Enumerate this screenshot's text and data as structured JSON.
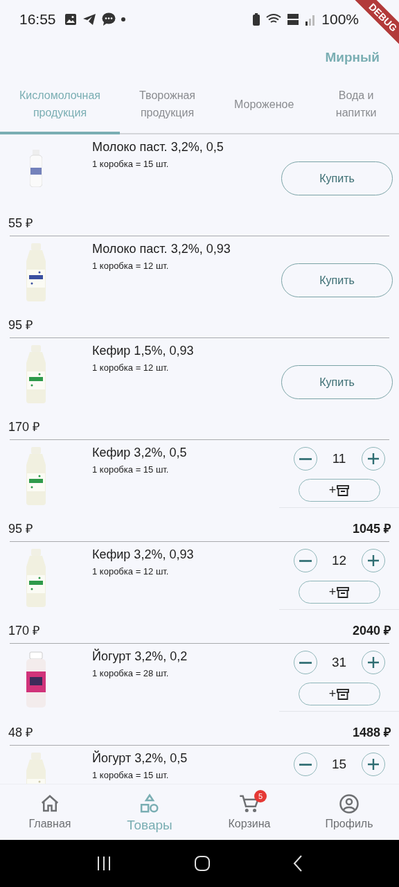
{
  "status_bar": {
    "time": "16:55",
    "battery": "100%"
  },
  "debug_banner": "DEBUG",
  "header": {
    "city": "Мирный"
  },
  "tabs": [
    {
      "label": "Кисломолочная продукция",
      "selected": true
    },
    {
      "label": "Творожная продукция",
      "selected": false
    },
    {
      "label": "Мороженое",
      "selected": false
    },
    {
      "label": "Вода и напитки",
      "selected": false
    }
  ],
  "products": [
    {
      "kind": "buy",
      "name": "Молоко паст. 3,2%, 0,5",
      "pack": "1 коробка = 15 шт.",
      "price": "55 ₽",
      "button": "Купить"
    },
    {
      "kind": "buy",
      "name": "Молоко паст. 3,2%, 0,93",
      "pack": "1 коробка = 12 шт.",
      "price": "95 ₽",
      "button": "Купить"
    },
    {
      "kind": "buy",
      "name": "Кефир 1,5%, 0,93",
      "pack": "1 коробка = 12 шт.",
      "price": "170 ₽",
      "button": "Купить"
    },
    {
      "kind": "cart",
      "name": "Кефир 3,2%, 0,5",
      "pack": "1 коробка = 15 шт.",
      "price": "95 ₽",
      "quantity": "11",
      "box_button": "+",
      "total": "1045 ₽"
    },
    {
      "kind": "cart",
      "name": "Кефир 3,2%, 0,93",
      "pack": "1 коробка = 12 шт.",
      "price": "170 ₽",
      "quantity": "12",
      "box_button": "+",
      "total": "2040 ₽"
    },
    {
      "kind": "cart",
      "name": "Йогурт 3,2%, 0,2",
      "pack": "1 коробка = 28 шт.",
      "price": "48 ₽",
      "quantity": "31",
      "box_button": "+",
      "total": "1488 ₽"
    },
    {
      "kind": "cart",
      "name": "Йогурт 3,2%, 0,5",
      "pack": "1 коробка = 15 шт.",
      "quantity": "15"
    }
  ],
  "bottom_nav": [
    {
      "kind": "home",
      "label": "Главная",
      "selected": false
    },
    {
      "kind": "shapes",
      "label": "Товары",
      "selected": true
    },
    {
      "kind": "cart",
      "label": "Корзина",
      "selected": false,
      "badge": "5"
    },
    {
      "kind": "profile",
      "label": "Профиль",
      "selected": false
    }
  ]
}
